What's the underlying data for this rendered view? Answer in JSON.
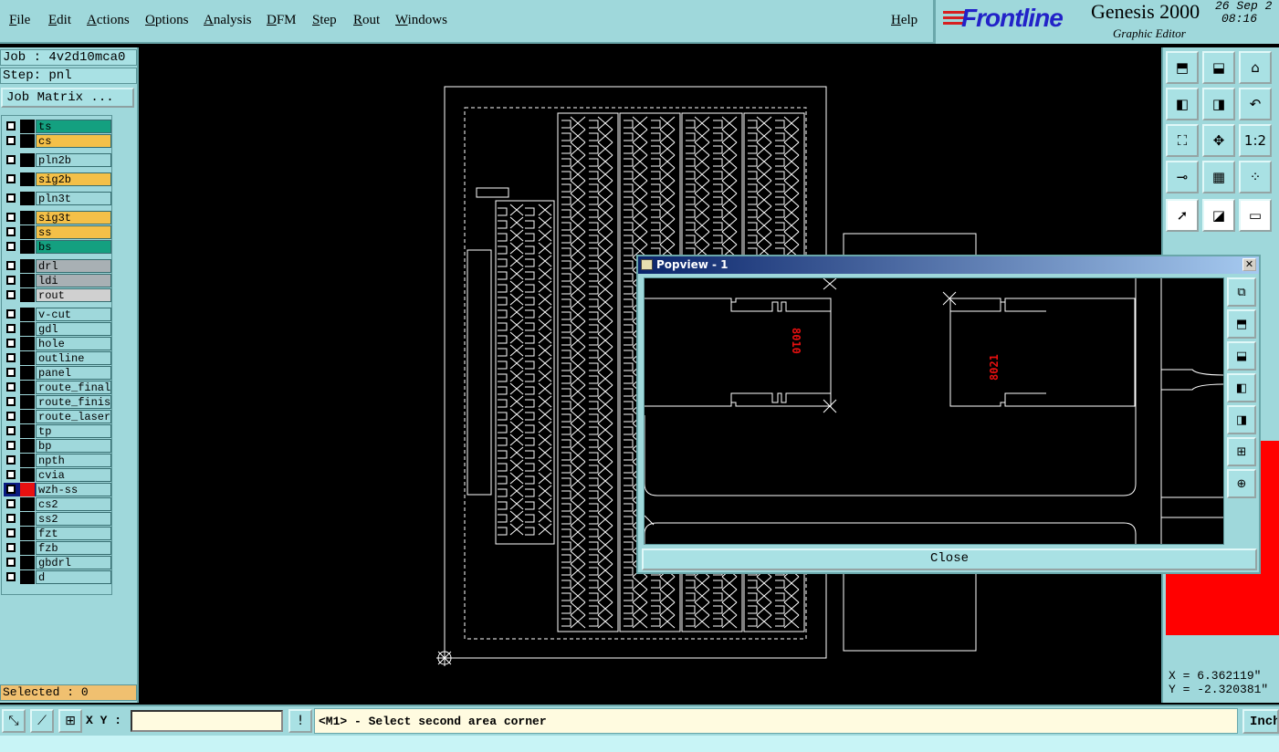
{
  "menu": {
    "items": [
      "File",
      "Edit",
      "Actions",
      "Options",
      "Analysis",
      "DFM",
      "Step",
      "Rout",
      "Windows"
    ],
    "help": "Help"
  },
  "brand": {
    "logo": "Frontline",
    "product": "Genesis 2000",
    "subtitle": "Graphic Editor",
    "date": "26 Sep 2",
    "time": "08:16 "
  },
  "left": {
    "job": "Job : 4v2d10mca0",
    "step": "Step: pnl",
    "job_matrix": "Job Matrix ...",
    "selected": "Selected : 0",
    "layers": [
      {
        "name": "ts",
        "bg": "#14a080",
        "color": "#000000"
      },
      {
        "name": "cs",
        "bg": "#f4c048",
        "color": "#000000"
      },
      {
        "name": "pln2b",
        "bg": "#9fd8db",
        "color": "#000000"
      },
      {
        "name": "sig2b",
        "bg": "#f4c048",
        "color": "#000000"
      },
      {
        "name": "pln3t",
        "bg": "#9fd8db",
        "color": "#000000"
      },
      {
        "name": "sig3t",
        "bg": "#f4c048",
        "color": "#000000"
      },
      {
        "name": "ss",
        "bg": "#f4c048",
        "color": "#000000"
      },
      {
        "name": "bs",
        "bg": "#14a080",
        "color": "#000000"
      },
      {
        "name": "drl",
        "bg": "#a8b0b4",
        "color": "#000000"
      },
      {
        "name": "ldi",
        "bg": "#a8b0b4",
        "color": "#000000"
      },
      {
        "name": "rout",
        "bg": "#d0d0d0",
        "color": "#000000"
      },
      {
        "name": "v-cut",
        "bg": "#9fd8db",
        "color": "#000000"
      },
      {
        "name": "gdl",
        "bg": "#9fd8db",
        "color": "#000000"
      },
      {
        "name": "hole",
        "bg": "#9fd8db",
        "color": "#000000"
      },
      {
        "name": "outline",
        "bg": "#9fd8db",
        "color": "#000000"
      },
      {
        "name": "panel",
        "bg": "#9fd8db",
        "color": "#000000"
      },
      {
        "name": "route_final",
        "bg": "#9fd8db",
        "color": "#000000"
      },
      {
        "name": "route_finish",
        "bg": "#9fd8db",
        "color": "#000000"
      },
      {
        "name": "route_laser",
        "bg": "#9fd8db",
        "color": "#000000"
      },
      {
        "name": "tp",
        "bg": "#9fd8db",
        "color": "#000000"
      },
      {
        "name": "bp",
        "bg": "#9fd8db",
        "color": "#000000"
      },
      {
        "name": "npth",
        "bg": "#9fd8db",
        "color": "#000000"
      },
      {
        "name": "cvia",
        "bg": "#9fd8db",
        "color": "#000000"
      },
      {
        "name": "wzh-ss",
        "bg": "#9fd8db",
        "color": "#e81010",
        "active": true
      },
      {
        "name": "cs2",
        "bg": "#9fd8db",
        "color": "#000000"
      },
      {
        "name": "ss2",
        "bg": "#9fd8db",
        "color": "#000000"
      },
      {
        "name": "fzt",
        "bg": "#9fd8db",
        "color": "#000000"
      },
      {
        "name": "fzb",
        "bg": "#9fd8db",
        "color": "#000000"
      },
      {
        "name": "gbdrl",
        "bg": "#9fd8db",
        "color": "#000000"
      },
      {
        "name": "d",
        "bg": "#9fd8db",
        "color": "#000000"
      }
    ]
  },
  "popview": {
    "title": "Popview - 1",
    "close_label": "Close",
    "labels": [
      "8010",
      "8021"
    ]
  },
  "coords": {
    "x": "X = 6.362119\"",
    "y": "Y = -2.320381\""
  },
  "status": {
    "xy_label": "X Y :",
    "xy_value": "",
    "prompt": "<M1> - Select second area corner",
    "unit": "Inch"
  },
  "colors": {
    "panel_bg": "#9fd8db",
    "canvas_bg": "#000000",
    "board_line": "#ffffff",
    "highlight": "#e81010"
  }
}
